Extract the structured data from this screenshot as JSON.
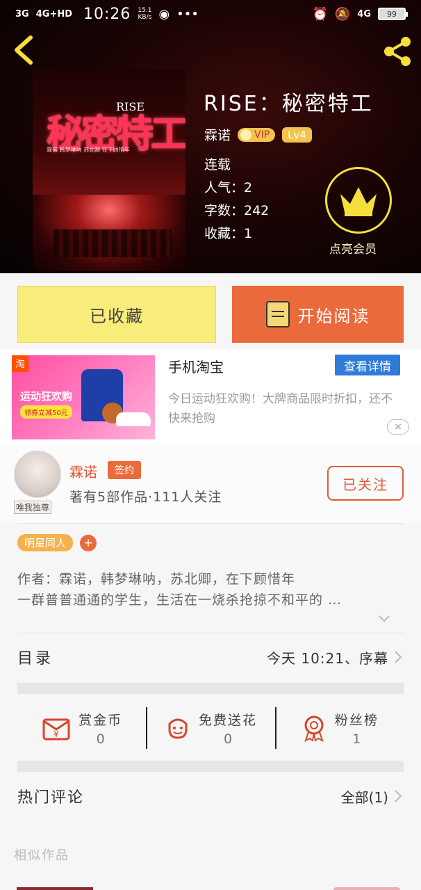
{
  "status_bar": {
    "network_left": "3G",
    "network_4g": "4G+HD",
    "time": "10:26",
    "speed_value": "15.1",
    "speed_unit": "KB/s",
    "network_right": "4G",
    "battery": "99"
  },
  "book": {
    "title": "RISE：秘密特工",
    "author": "霖诺",
    "vip_label": "VIP",
    "level": "Lv4",
    "status": "连载",
    "popularity": "人气：2",
    "word_count": "字数：242",
    "favorites": "收藏：1",
    "cover_title": "秘密特工",
    "cover_rise": "RISE",
    "cover_sub": "霖诺 韩梦琳呐 苏北卿 在下顾惜年"
  },
  "member": {
    "label": "点亮会员"
  },
  "actions": {
    "collected": "已收藏",
    "start_reading": "开始阅读"
  },
  "ad": {
    "title": "手机淘宝",
    "details_button": "查看详情",
    "description": "今日运动狂欢购！大牌商品限时折扣，还不快来抢购",
    "promo": "运动狂欢购",
    "coupon": "领券立减50元",
    "tao": "淘",
    "close": "×"
  },
  "author_info": {
    "name": "霖诺",
    "signed": "签约",
    "stats": "著有5部作品·111人关注",
    "follow": "已关注",
    "avatar_tag": "唯我独尊"
  },
  "tags": {
    "items": [
      "明星同人"
    ],
    "add": "+"
  },
  "synopsis": {
    "line1": "作者：霖诺，韩梦琳呐，苏北卿，在下顾惜年",
    "line2": "一群普普通通的学生，生活在一烧杀抢掠不和平的 …"
  },
  "toc": {
    "label": "目录",
    "latest": "今天 10:21、序幕"
  },
  "stats": {
    "reward_label": "赏金币",
    "reward_value": "0",
    "flower_label": "免费送花",
    "flower_value": "0",
    "fans_label": "粉丝榜",
    "fans_value": "1"
  },
  "comments": {
    "label": "热门评论",
    "all": "全部(1)"
  },
  "similar": {
    "label": "相似作品"
  },
  "colors": {
    "accent": "#ea6a3b",
    "gold": "#f6df3b",
    "ad_blue": "#2f7bd8",
    "collected_bg": "#f8ec7a"
  }
}
